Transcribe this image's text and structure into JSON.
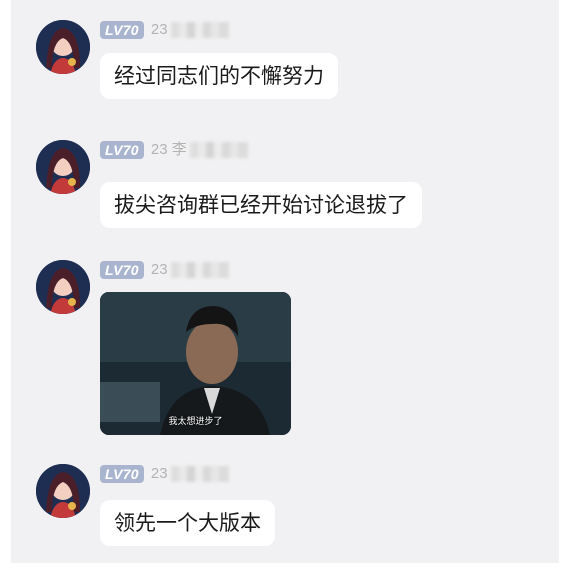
{
  "messages": [
    {
      "level": "LV70",
      "uid_visible": "23",
      "type": "text",
      "text": "经过同志们的不懈努力"
    },
    {
      "level": "LV70",
      "uid_visible": "23 李",
      "type": "text",
      "text": "拔尖咨询群已经开始讨论退拔了"
    },
    {
      "level": "LV70",
      "uid_visible": "23",
      "type": "image",
      "image_caption": "我太想进步了"
    },
    {
      "level": "LV70",
      "uid_visible": "23",
      "type": "text",
      "text": "领先一个大版本"
    }
  ],
  "icons": {
    "avatar": "anime-girl-avatar-icon"
  },
  "colors": {
    "chat_bg": "#f1f1f3",
    "bubble": "#ffffff",
    "level_badge": "#a9b5cf",
    "uid_text": "#b3b3b3"
  }
}
